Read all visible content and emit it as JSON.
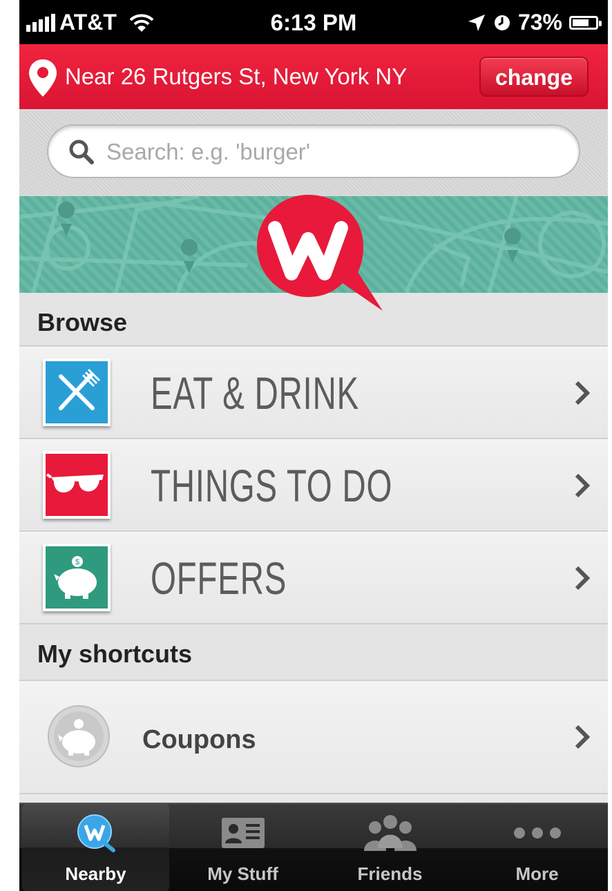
{
  "status_bar": {
    "carrier": "AT&T",
    "time": "6:13 PM",
    "battery": "73%",
    "battery_level": 0.73
  },
  "location_bar": {
    "text": "Near 26 Rutgers St,  New York NY",
    "change_label": "change",
    "accent_color": "#e8193a"
  },
  "search": {
    "placeholder": "Search: e.g. 'burger'"
  },
  "browse": {
    "header": "Browse",
    "items": [
      {
        "label": "EAT & DRINK",
        "icon": "fork-knife-icon",
        "color": "#2a9fd6"
      },
      {
        "label": "THINGS TO DO",
        "icon": "sunglasses-icon",
        "color": "#e8193a"
      },
      {
        "label": "OFFERS",
        "icon": "piggy-bank-icon",
        "color": "#2f9a7e"
      }
    ]
  },
  "shortcuts": {
    "header": "My shortcuts",
    "items": [
      {
        "label": "Coupons",
        "icon": "piggy-bank-icon"
      }
    ]
  },
  "tabbar": {
    "tabs": [
      {
        "label": "Nearby",
        "icon": "nearby-w-icon",
        "active": true
      },
      {
        "label": "My Stuff",
        "icon": "id-card-icon",
        "active": false
      },
      {
        "label": "Friends",
        "icon": "people-icon",
        "active": false
      },
      {
        "label": "More",
        "icon": "more-dots-icon",
        "active": false
      }
    ]
  }
}
